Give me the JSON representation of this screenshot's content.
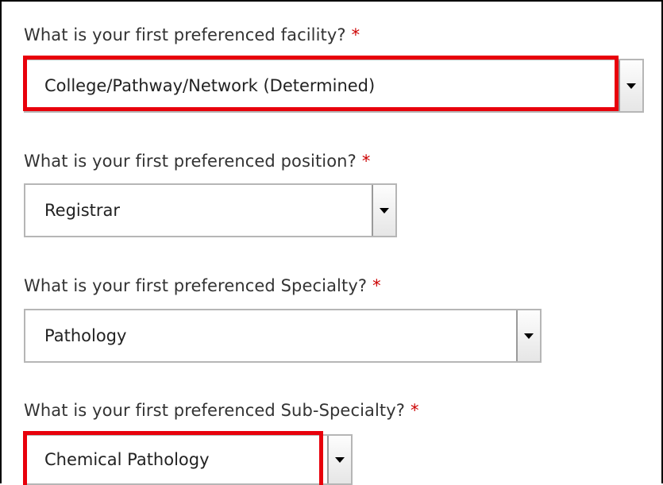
{
  "colors": {
    "highlight": "#e8000b",
    "required_marker": "#cc0000",
    "frame_border": "#000000"
  },
  "form": {
    "required_marker": "*",
    "questions": [
      {
        "label": "What is your first preferenced facility?",
        "selected": "College/Pathway/Network (Determined)",
        "highlighted": true
      },
      {
        "label": "What is your first preferenced position?",
        "selected": "Registrar",
        "highlighted": false
      },
      {
        "label": "What is your first preferenced Specialty?",
        "selected": "Pathology",
        "highlighted": false
      },
      {
        "label": "What is your first preferenced Sub-Specialty?",
        "selected": "Chemical Pathology",
        "highlighted": true
      }
    ]
  },
  "icons": {
    "dropdown": "chevron-down-icon"
  }
}
